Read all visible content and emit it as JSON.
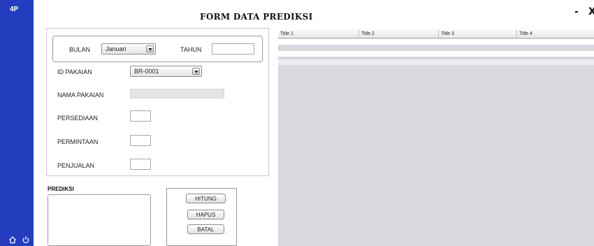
{
  "app": {
    "logo": "4P",
    "title": "FORM DATA PREDIKSI",
    "minimize_label": "-",
    "close_label": "X"
  },
  "sidebar": {
    "icons": [
      "home-icon",
      "power-icon"
    ]
  },
  "colors": {
    "sidebar": "#243dbf",
    "table_bg": "#d7d9df",
    "readonly_field": "#e3e4e6"
  },
  "period": {
    "bulan_label": "BULAN",
    "bulan_value": "Januari",
    "tahun_label": "TAHUN",
    "tahun_value": ""
  },
  "form": {
    "id_pakaian_label": "ID PAKAIAN",
    "id_pakaian_value": "BR-0001",
    "nama_pakaian_label": "NAMA PAKAIAN",
    "nama_pakaian_value": "",
    "persediaan_label": "PERSEDIAAN",
    "permintaan_label": "PERMINTAAN",
    "penjualan_label": "PENJUALAN"
  },
  "prediksi": {
    "label": "PREDIKSI",
    "value": ""
  },
  "buttons": {
    "hitung": "HITUNG",
    "hapus": "HAPUS",
    "batal": "BATAL"
  },
  "table": {
    "headers": [
      "Title 1",
      "Title 2",
      "Title 3",
      "Title 4"
    ],
    "rows": [
      [
        "",
        "",
        "",
        ""
      ],
      [
        "",
        "",
        "",
        ""
      ],
      [
        "",
        "",
        "",
        ""
      ]
    ]
  }
}
